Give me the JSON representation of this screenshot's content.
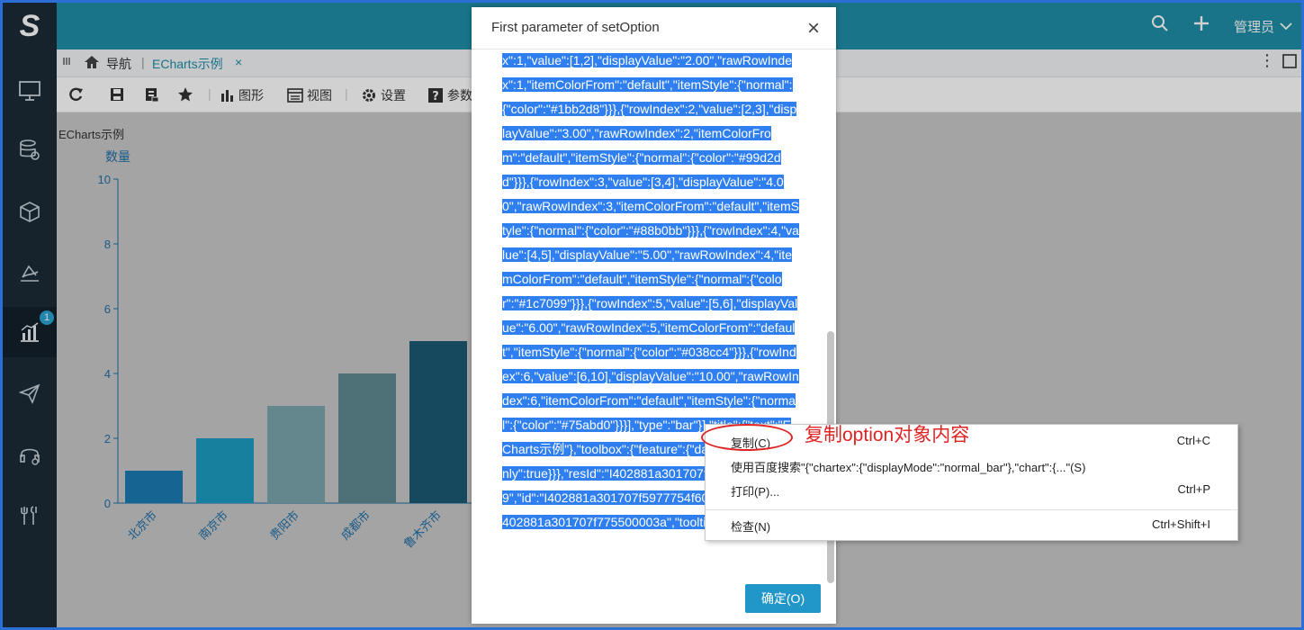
{
  "header": {
    "logo_text": "S",
    "admin_label": "管理员",
    "icons": [
      "search-icon",
      "plus-icon",
      "chevron-down-icon"
    ]
  },
  "sidebar": {
    "items": [
      {
        "icon": "monitor-icon"
      },
      {
        "icon": "database-settings-icon"
      },
      {
        "icon": "cube-icon"
      },
      {
        "icon": "analysis-icon"
      },
      {
        "icon": "bar-chart-icon",
        "badge": "1",
        "active": true
      },
      {
        "icon": "send-icon"
      },
      {
        "icon": "headset-icon"
      },
      {
        "icon": "tools-icon"
      }
    ]
  },
  "tabs": {
    "nav_label": "导航",
    "active_tab": "ECharts示例",
    "close_glyph": "×"
  },
  "toolbar": {
    "graph_label": "图形",
    "view_label": "视图",
    "settings_label": "设置",
    "params_label": "参数"
  },
  "chart_data": {
    "type": "bar",
    "title": "ECharts示例",
    "ylabel": "数量",
    "xlabel": "",
    "ylim": [
      0,
      10
    ],
    "yticks": [
      0,
      2,
      4,
      6,
      8,
      10
    ],
    "categories": [
      "北京市",
      "南京市",
      "贵阳市",
      "成都市",
      "鲁木齐市"
    ],
    "values": [
      1,
      2,
      3,
      4,
      5
    ],
    "colors": [
      "#1b7ab3",
      "#1b9dc1",
      "#79a5ad",
      "#5f8a91",
      "#1c5a73"
    ],
    "grid": false,
    "legend": "none"
  },
  "modal": {
    "title": "First parameter of setOption",
    "close_glyph": "×",
    "json_text": "x\":1,\"value\":[1,2],\"displayValue\":\"2.00\",\"rawRowIndex\":1,\"itemColorFrom\":\"default\",\"itemStyle\":{\"normal\":{\"color\":\"#1bb2d8\"}}},{\"rowIndex\":2,\"value\":[2,3],\"displayValue\":\"3.00\",\"rawRowIndex\":2,\"itemColorFrom\":\"default\",\"itemStyle\":{\"normal\":{\"color\":\"#99d2dd\"}}},{\"rowIndex\":3,\"value\":[3,4],\"displayValue\":\"4.00\",\"rawRowIndex\":3,\"itemColorFrom\":\"default\",\"itemStyle\":{\"normal\":{\"color\":\"#88b0bb\"}}},{\"rowIndex\":4,\"value\":[4,5],\"displayValue\":\"5.00\",\"rawRowIndex\":4,\"itemColorFrom\":\"default\",\"itemStyle\":{\"normal\":{\"color\":\"#1c7099\"}}},{\"rowIndex\":5,\"value\":[5,6],\"displayValue\":\"6.00\",\"rawRowIndex\":5,\"itemColorFrom\":\"default\",\"itemStyle\":{\"normal\":{\"color\":\"#038cc4\"}}},{\"rowIndex\":6,\"value\":[6,10],\"displayValue\":\"10.00\",\"rawRowIndex\":6,\"itemColorFrom\":\"default\",\"itemStyle\":{\"normal\":{\"color\":\"#75abd0\"}}}],\"type\":\"bar\"}],\"title\":{\"text\":\"ECharts示例\"},\"toolbox\":{\"feature\":{\"dataView\":{\"readOnly\":true}}},\"resId\":\"I402881a301707f5977754f60039\",\"id\":\"I402881a301707f5977754f60039\",\"resId2\":\"I402881a301707f775500003a\",\"tooltip\":{},\"grid\":{}}",
    "ok_label": "确定(O)"
  },
  "context_menu": {
    "items": [
      {
        "label": "复制(C)",
        "shortcut": "Ctrl+C"
      },
      {
        "label": "使用百度搜索\"{\"chartex\":{\"displayMode\":\"normal_bar\"},\"chart\":{...\"(S)",
        "shortcut": ""
      },
      {
        "label": "打印(P)...",
        "shortcut": "Ctrl+P"
      },
      {
        "label": "检查(N)",
        "shortcut": "Ctrl+Shift+I"
      }
    ]
  },
  "annotation": {
    "text": "复制option对象内容",
    "color": "#e02424"
  }
}
